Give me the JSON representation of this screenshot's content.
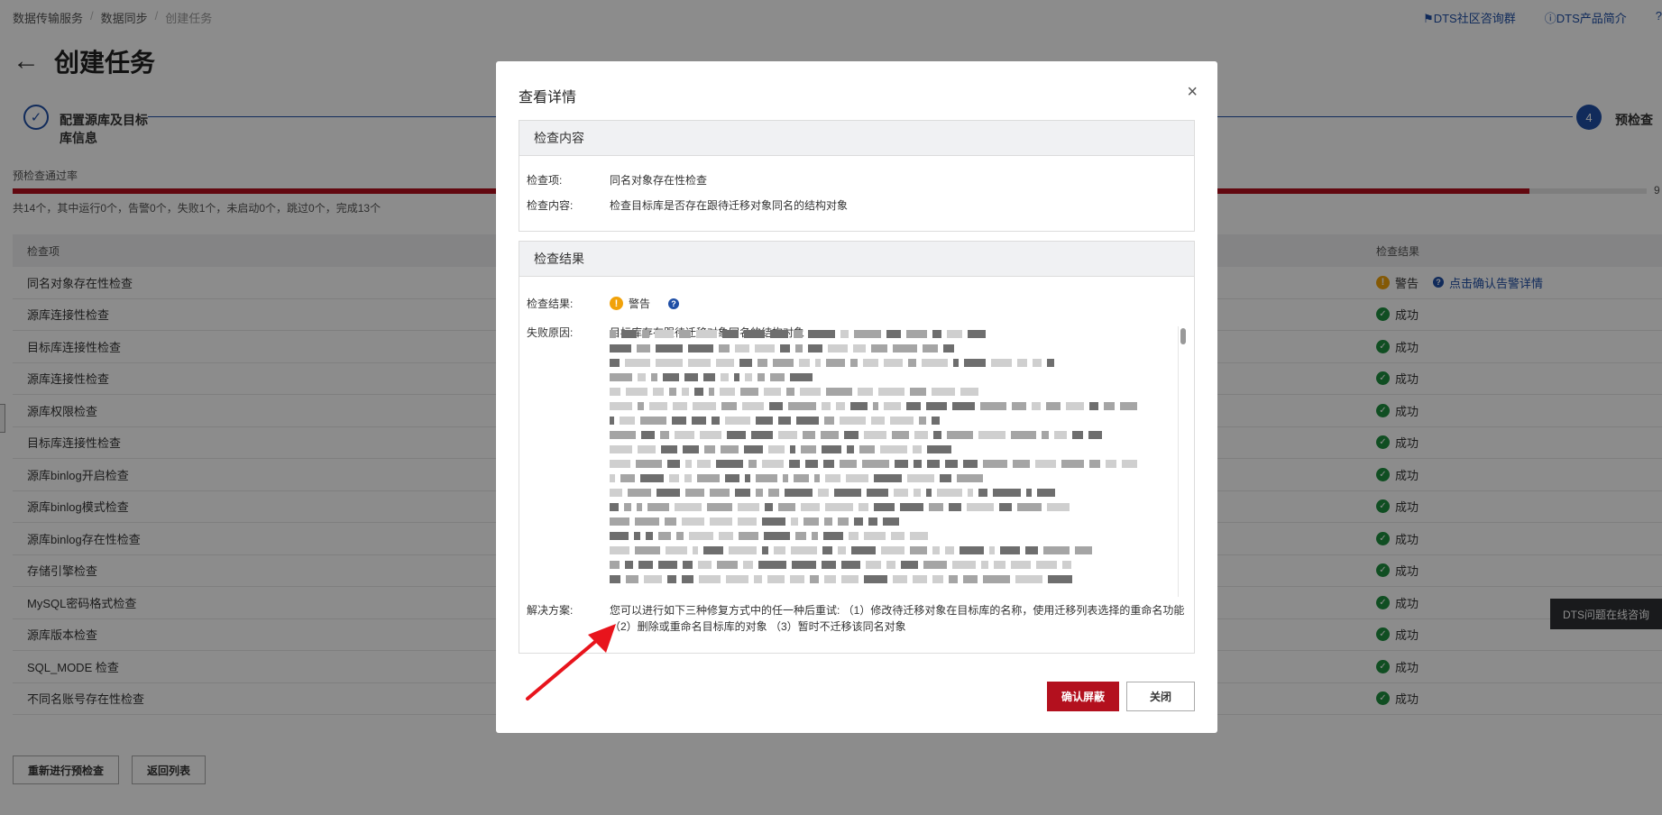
{
  "breadcrumb": {
    "item1": "数据传输服务",
    "item2": "数据同步",
    "current": "创建任务",
    "sep": "/"
  },
  "top_links": {
    "community": "DTS社区咨询群",
    "intro": "DTS产品简介",
    "more": "?"
  },
  "page": {
    "back": "←",
    "title": "创建任务"
  },
  "steps": {
    "step1_label": "配置源库及目标库信息",
    "step1_check": "✓",
    "step4_num": "4",
    "step4_label": "预检查"
  },
  "precheck": {
    "rate_label": "预检查通过率",
    "rate_value": "9",
    "rate_fraction": 0.928,
    "summary": "共14个，其中运行0个，告警0个，失败1个，未启动0个，跳过0个，完成13个"
  },
  "table": {
    "col_item": "检查项",
    "col_result": "检查结果",
    "rows": [
      {
        "name": "同名对象存在性检查",
        "status": "警告",
        "link": "点击确认告警详情"
      },
      {
        "name": "源库连接性检查",
        "status": "成功"
      },
      {
        "name": "目标库连接性检查",
        "status": "成功"
      },
      {
        "name": "源库连接性检查",
        "status": "成功"
      },
      {
        "name": "源库权限检查",
        "status": "成功"
      },
      {
        "name": "目标库连接性检查",
        "status": "成功"
      },
      {
        "name": "源库binlog开启检查",
        "status": "成功"
      },
      {
        "name": "源库binlog模式检查",
        "status": "成功"
      },
      {
        "name": "源库binlog存在性检查",
        "status": "成功"
      },
      {
        "name": "存储引擎检查",
        "status": "成功"
      },
      {
        "name": "MySQL密码格式检查",
        "status": "成功"
      },
      {
        "name": "源库版本检查",
        "status": "成功"
      },
      {
        "name": "SQL_MODE 检查",
        "status": "成功"
      },
      {
        "name": "不同名账号存在性检查",
        "status": "成功"
      }
    ]
  },
  "buttons": {
    "recheck": "重新进行预检查",
    "back_list": "返回列表"
  },
  "float_consult": "DTS问题在线咨询",
  "dialog": {
    "title": "查看详情",
    "close_icon": "×",
    "section1_title": "检查内容",
    "check_item_label": "检查项:",
    "check_item_value": "同名对象存在性检查",
    "check_content_label": "检查内容:",
    "check_content_value": "检查目标库是否存在跟待迁移对象同名的结构对象",
    "section2_title": "检查结果",
    "result_label": "检查结果:",
    "result_value": "警告",
    "fail_reason_label": "失败原因:",
    "fail_reason_value": "目标库存在跟待迁移对象同名的结构对象",
    "solution_label": "解决方案:",
    "solution_value": "您可以进行如下三种修复方式中的任一种后重试: （1）修改待迁移对象在目标库的名称，使用迁移列表选择的重命名功能 （2）删除或重命名目标库的对象 （3）暂时不迁移该同名对象",
    "confirm_button": "确认屏蔽",
    "close_button": "关闭"
  },
  "colors": {
    "brand_red": "#b3101e",
    "link_blue": "#1f4fa6",
    "success_green": "#1e8e3e",
    "warn_orange": "#f1a20a"
  }
}
